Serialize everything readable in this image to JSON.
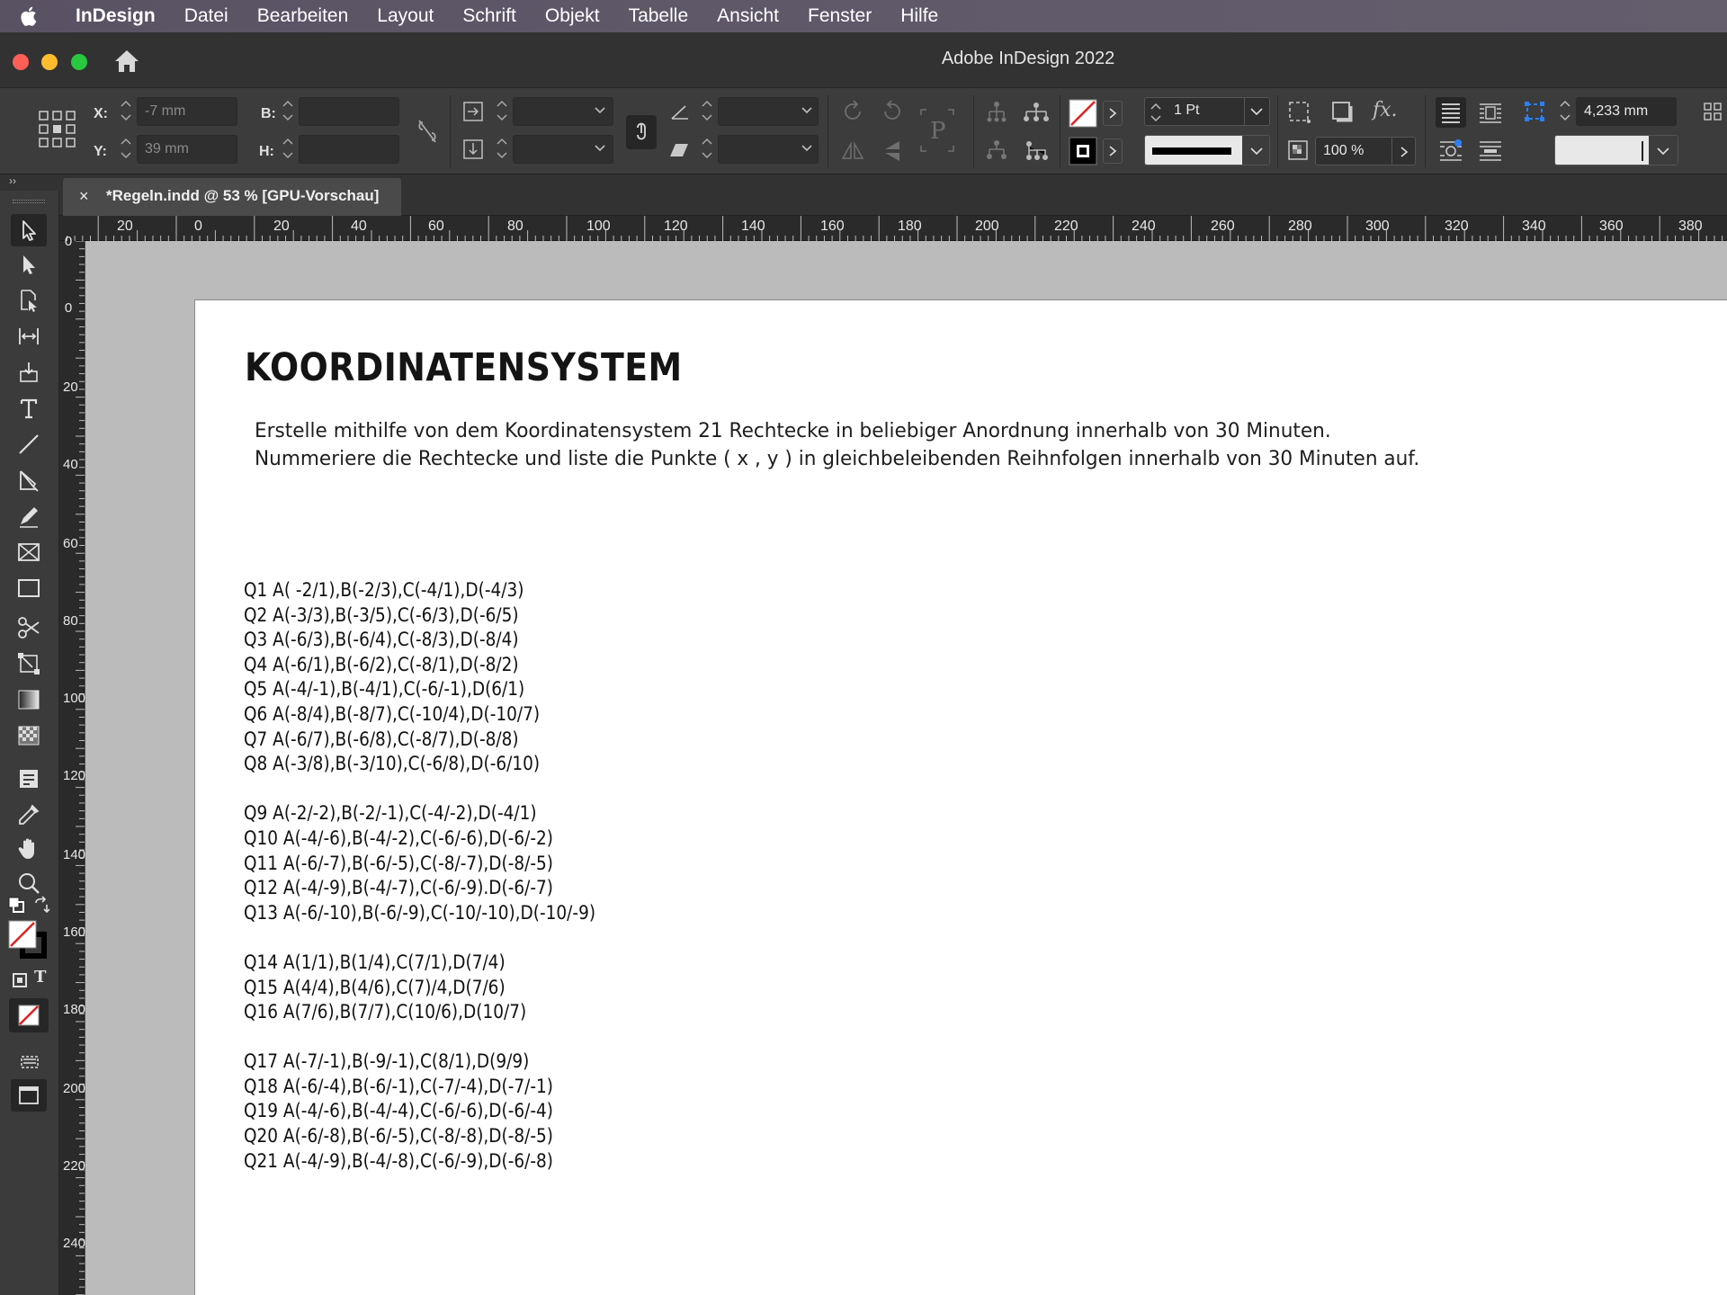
{
  "menubar": {
    "app": "InDesign",
    "items": [
      "Datei",
      "Bearbeiten",
      "Layout",
      "Schrift",
      "Objekt",
      "Tabelle",
      "Ansicht",
      "Fenster",
      "Hilfe"
    ]
  },
  "window": {
    "title": "Adobe InDesign 2022"
  },
  "control": {
    "x_label": "X:",
    "x_value": "-7 mm",
    "y_label": "Y:",
    "y_value": "39 mm",
    "w_label": "B:",
    "h_label": "H:",
    "stroke_weight": "1 Pt",
    "opacity": "100 %",
    "offset": "4,233 mm"
  },
  "tab": {
    "close": "×",
    "title": "*Regeln.indd @ 53 % [GPU-Vorschau]",
    "panel_toggle": "››"
  },
  "ruler": {
    "h_labels": [
      "20",
      "0",
      "20",
      "40",
      "60",
      "80",
      "100",
      "120",
      "140",
      "160",
      "180",
      "200",
      "220",
      "240",
      "260",
      "280",
      "300",
      "320",
      "340",
      "360",
      "380"
    ],
    "v_labels": [
      "0",
      "0",
      "20",
      "40",
      "60",
      "80",
      "100",
      "120",
      "140",
      "160",
      "180",
      "200",
      "220",
      "240"
    ]
  },
  "document": {
    "title": "KOORDINATENSYSTEM",
    "intro_1": "Erstelle mithilfe von dem Koordinatensystem 21 Rechtecke in beliebiger Anordnung innerhalb von 30 Minuten.",
    "intro_2": "Nummeriere die Rechtecke und liste die Punkte ( x , y ) in gleichbeleibenden Reihnfolgen innerhalb von 30 Minuten auf.",
    "groups": [
      [
        "Q1 A( -2/1),B(-2/3),C(-4/1),D(-4/3)",
        "Q2 A(-3/3),B(-3/5),C(-6/3),D(-6/5)",
        "Q3 A(-6/3),B(-6/4),C(-8/3),D(-8/4)",
        "Q4 A(-6/1),B(-6/2),C(-8/1),D(-8/2)",
        "Q5 A(-4/-1),B(-4/1),C(-6/-1),D(6/1)",
        "Q6 A(-8/4),B(-8/7),C(-10/4),D(-10/7)",
        "Q7 A(-6/7),B(-6/8),C(-8/7),D(-8/8)",
        "Q8 A(-3/8),B(-3/10),C(-6/8),D(-6/10)"
      ],
      [
        "Q9 A(-2/-2),B(-2/-1),C(-4/-2),D(-4/1)",
        "Q10 A(-4/-6),B(-4/-2),C(-6/-6),D(-6/-2)",
        "Q11 A(-6/-7),B(-6/-5),C(-8/-7),D(-8/-5)",
        "Q12 A(-4/-9),B(-4/-7),C(-6/-9).D(-6/-7)",
        "Q13 A(-6/-10),B(-6/-9),C(-10/-10),D(-10/-9)"
      ],
      [
        "Q14 A(1/1),B(1/4),C(7/1),D(7/4)",
        "Q15 A(4/4),B(4/6),C(7)/4,D(7/6)",
        "Q16 A(7/6),B(7/7),C(10/6),D(10/7)"
      ],
      [
        "Q17 A(-7/-1),B(-9/-1),C(8/1),D(9/9)",
        "Q18 A(-6/-4),B(-6/-1),C(-7/-4),D(-7/-1)",
        "Q19 A(-4/-6),B(-4/-4),C(-6/-6),D(-6/-4)",
        "Q20 A(-6/-8),B(-6/-5),C(-8/-8),D(-8/-5)",
        "Q21 A(-4/-9),B(-4/-8),C(-6/-9),D(-6/-8)"
      ]
    ]
  },
  "colors": {
    "menubar": "#5e5869",
    "chrome": "#3c3c3c",
    "pasteboard": "#bbbbbb",
    "page": "#ffffff",
    "accent": "#2d7ff0",
    "stroke_none": "#e02020"
  }
}
